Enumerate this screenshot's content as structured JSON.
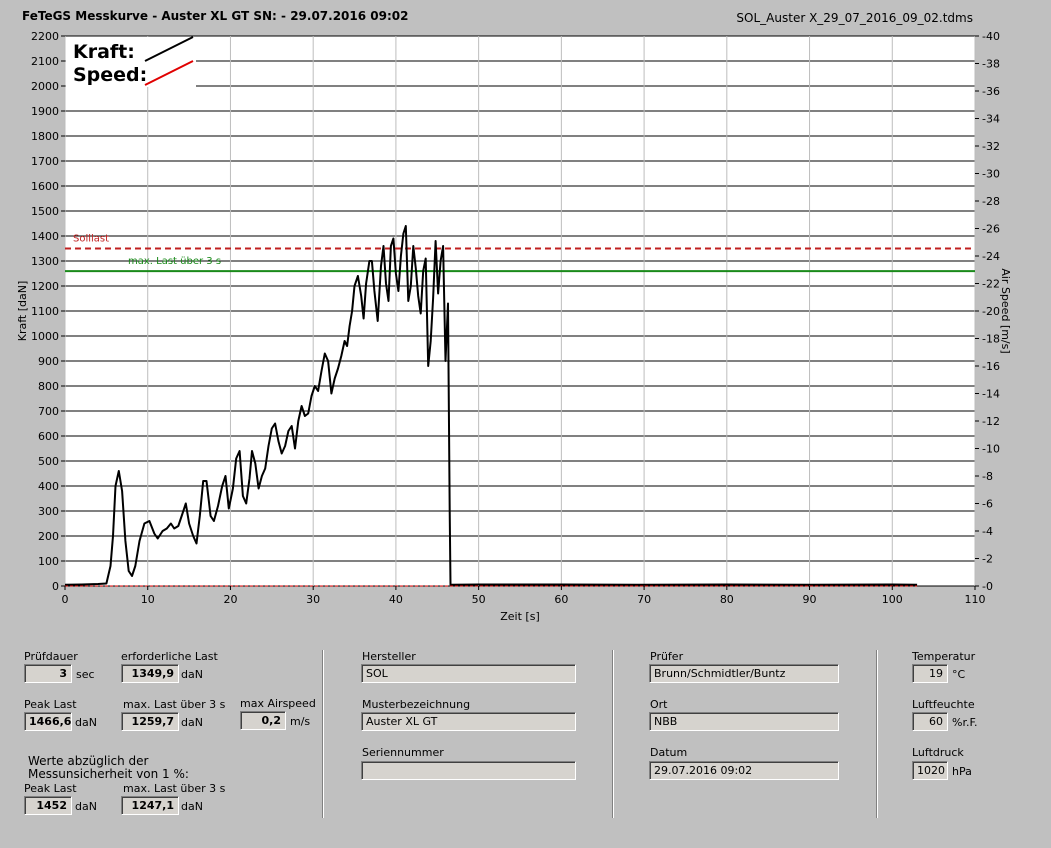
{
  "header": {
    "title": "FeTeGS Messkurve - Auster XL GT  SN:  - 29.07.2016 09:02",
    "file": "SOL_Auster X_29_07_2016_09_02.tdms"
  },
  "legend": {
    "kraft": "Kraft:",
    "speed": "Speed:",
    "kraft_color": "#000000",
    "speed_color": "#e00000"
  },
  "chart_data": {
    "type": "line",
    "xlabel": "Zeit [s]",
    "ylabel": "Kraft [daN]",
    "y2label": "Air Speed [m/s]",
    "xlim": [
      0,
      110
    ],
    "ylim": [
      0,
      2200
    ],
    "y2lim": [
      0,
      40
    ],
    "xticks": [
      "0",
      "10",
      "20",
      "30",
      "40",
      "50",
      "60",
      "70",
      "80",
      "90",
      "100",
      "110"
    ],
    "yticks": [
      "0",
      "100",
      "200",
      "300",
      "400",
      "500",
      "600",
      "700",
      "800",
      "900",
      "1000",
      "1100",
      "1200",
      "1300",
      "1400",
      "1500",
      "1600",
      "1700",
      "1800",
      "1900",
      "2000",
      "2100",
      "2200"
    ],
    "y2ticks": [
      "0",
      "2",
      "4",
      "6",
      "8",
      "10",
      "12",
      "14",
      "16",
      "18",
      "20",
      "22",
      "24",
      "26",
      "28",
      "30",
      "32",
      "34",
      "36",
      "38",
      "40"
    ],
    "grid": true,
    "reference_lines": [
      {
        "label": "Solllast",
        "value": 1349.9,
        "color": "#c02020",
        "style": "dashed"
      },
      {
        "label": "max. Last über  3 s",
        "value": 1259.7,
        "color": "#1a8a1a",
        "style": "solid"
      }
    ],
    "series": [
      {
        "name": "Kraft",
        "color": "#000000",
        "points": [
          [
            0,
            5
          ],
          [
            2,
            6
          ],
          [
            4,
            8
          ],
          [
            5,
            10
          ],
          [
            5.5,
            80
          ],
          [
            5.8,
            200
          ],
          [
            6.1,
            400
          ],
          [
            6.5,
            460
          ],
          [
            6.9,
            380
          ],
          [
            7.3,
            180
          ],
          [
            7.7,
            60
          ],
          [
            8.1,
            40
          ],
          [
            8.5,
            80
          ],
          [
            9,
            180
          ],
          [
            9.6,
            250
          ],
          [
            10.2,
            260
          ],
          [
            10.8,
            210
          ],
          [
            11.2,
            190
          ],
          [
            11.8,
            220
          ],
          [
            12.3,
            230
          ],
          [
            12.8,
            250
          ],
          [
            13.2,
            230
          ],
          [
            13.7,
            240
          ],
          [
            14.2,
            290
          ],
          [
            14.6,
            330
          ],
          [
            15,
            250
          ],
          [
            15.5,
            200
          ],
          [
            15.9,
            170
          ],
          [
            16.3,
            280
          ],
          [
            16.7,
            420
          ],
          [
            17.1,
            420
          ],
          [
            17.6,
            280
          ],
          [
            18,
            260
          ],
          [
            18.5,
            320
          ],
          [
            19,
            400
          ],
          [
            19.4,
            440
          ],
          [
            19.8,
            310
          ],
          [
            20.3,
            390
          ],
          [
            20.7,
            510
          ],
          [
            21.1,
            540
          ],
          [
            21.5,
            360
          ],
          [
            21.9,
            330
          ],
          [
            22.3,
            430
          ],
          [
            22.6,
            540
          ],
          [
            23,
            490
          ],
          [
            23.4,
            390
          ],
          [
            23.8,
            440
          ],
          [
            24.2,
            470
          ],
          [
            24.6,
            560
          ],
          [
            25,
            630
          ],
          [
            25.4,
            650
          ],
          [
            25.8,
            580
          ],
          [
            26.2,
            530
          ],
          [
            26.6,
            560
          ],
          [
            27,
            620
          ],
          [
            27.4,
            640
          ],
          [
            27.8,
            550
          ],
          [
            28.2,
            660
          ],
          [
            28.6,
            720
          ],
          [
            29,
            680
          ],
          [
            29.4,
            690
          ],
          [
            29.8,
            760
          ],
          [
            30.2,
            800
          ],
          [
            30.6,
            780
          ],
          [
            31,
            860
          ],
          [
            31.4,
            930
          ],
          [
            31.8,
            900
          ],
          [
            32.2,
            770
          ],
          [
            32.6,
            830
          ],
          [
            33,
            870
          ],
          [
            33.4,
            920
          ],
          [
            33.8,
            980
          ],
          [
            34.1,
            960
          ],
          [
            34.4,
            1040
          ],
          [
            34.7,
            1100
          ],
          [
            35,
            1200
          ],
          [
            35.4,
            1240
          ],
          [
            35.8,
            1160
          ],
          [
            36.1,
            1070
          ],
          [
            36.4,
            1210
          ],
          [
            36.8,
            1300
          ],
          [
            37.1,
            1300
          ],
          [
            37.4,
            1180
          ],
          [
            37.8,
            1060
          ],
          [
            38.2,
            1280
          ],
          [
            38.5,
            1360
          ],
          [
            38.8,
            1210
          ],
          [
            39.1,
            1140
          ],
          [
            39.4,
            1360
          ],
          [
            39.7,
            1390
          ],
          [
            40,
            1250
          ],
          [
            40.3,
            1180
          ],
          [
            40.6,
            1320
          ],
          [
            40.9,
            1410
          ],
          [
            41.2,
            1440
          ],
          [
            41.5,
            1140
          ],
          [
            41.8,
            1200
          ],
          [
            42.1,
            1360
          ],
          [
            42.4,
            1270
          ],
          [
            42.7,
            1160
          ],
          [
            43,
            1090
          ],
          [
            43.3,
            1260
          ],
          [
            43.6,
            1310
          ],
          [
            43.9,
            880
          ],
          [
            44.2,
            980
          ],
          [
            44.5,
            1150
          ],
          [
            44.8,
            1380
          ],
          [
            45.1,
            1170
          ],
          [
            45.4,
            1300
          ],
          [
            45.7,
            1360
          ],
          [
            46,
            900
          ],
          [
            46.3,
            1130
          ],
          [
            46.5,
            300
          ],
          [
            46.6,
            5
          ],
          [
            50,
            6
          ],
          [
            60,
            6
          ],
          [
            70,
            5
          ],
          [
            80,
            6
          ],
          [
            90,
            5
          ],
          [
            100,
            6
          ],
          [
            103,
            5
          ]
        ]
      },
      {
        "name": "Speed",
        "color": "#e00000",
        "points": [
          [
            0,
            0
          ],
          [
            103,
            0
          ]
        ]
      }
    ]
  },
  "panel": {
    "pruefdauer_label": "Prüfdauer",
    "pruefdauer_value": "3",
    "pruefdauer_unit": "sec",
    "erf_last_label": "erforderliche Last",
    "erf_last_value": "1349,9",
    "erf_last_unit": "daN",
    "peak_last_label": "Peak Last",
    "peak_last_value": "1466,6",
    "peak_last_unit": "daN",
    "max_last_label": "max. Last über  3 s",
    "max_last_value": "1259,7",
    "max_last_unit": "daN",
    "max_airspeed_label": "max Airspeed",
    "max_airspeed_value": "0,2",
    "max_airspeed_unit": "m/s",
    "werte_line1": "Werte abzüglich der",
    "werte_line2": "Messunsicherheit von 1  %:",
    "peak_last2_label": "Peak Last",
    "peak_last2_value": "1452",
    "peak_last2_unit": "daN",
    "max_last2_label": "max. Last über  3 s",
    "max_last2_value": "1247,1",
    "max_last2_unit": "daN",
    "hersteller_label": "Hersteller",
    "hersteller_value": "SOL",
    "muster_label": "Musterbezeichnung",
    "muster_value": "Auster XL GT",
    "serien_label": "Seriennummer",
    "serien_value": "",
    "pruefer_label": "Prüfer",
    "pruefer_value": "Brunn/Schmidtler/Buntz",
    "ort_label": "Ort",
    "ort_value": "NBB",
    "datum_label": "Datum",
    "datum_value": "29.07.2016 09:02",
    "temp_label": "Temperatur",
    "temp_value": "19",
    "temp_unit": "°C",
    "feuchte_label": "Luftfeuchte",
    "feuchte_value": "60",
    "feuchte_unit": "%r.F.",
    "druck_label": "Luftdruck",
    "druck_value": "1020",
    "druck_unit": "hPa"
  }
}
